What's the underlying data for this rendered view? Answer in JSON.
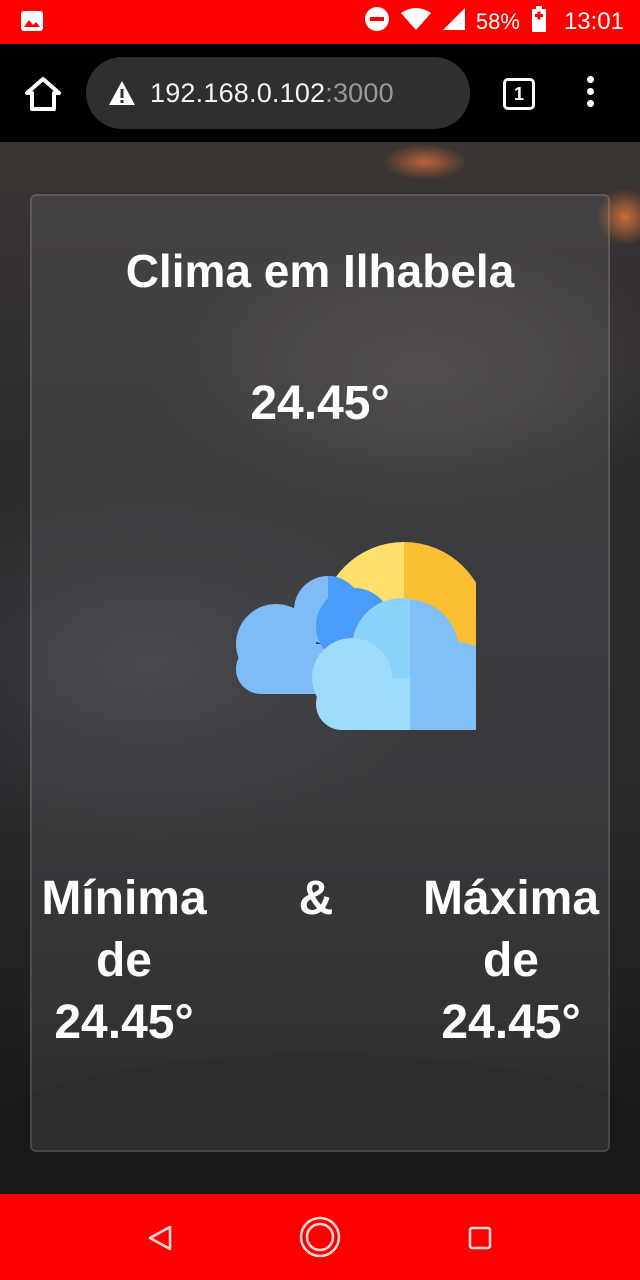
{
  "status_bar": {
    "battery": "58%",
    "time": "13:01",
    "icons": [
      "image-icon",
      "do-not-disturb-icon",
      "wifi-icon",
      "signal-icon",
      "battery-icon"
    ]
  },
  "browser": {
    "url_host": "192.168.0.102",
    "url_port": ":3000",
    "tab_count": "1",
    "icons": [
      "home-icon",
      "warning-icon",
      "tabs-icon",
      "menu-icon"
    ]
  },
  "weather": {
    "title": "Clima em Ilhabela",
    "temperature": "24.45°",
    "icon": "partly-cloudy-icon",
    "min_label_1": "Mínima",
    "min_label_2": "de",
    "min_value": "24.45°",
    "separator": "&",
    "max_label_1": "Máxima",
    "max_label_2": "de",
    "max_value": "24.45°"
  },
  "nav_bar": {
    "icons": [
      "back-icon",
      "home-circle-icon",
      "recent-apps-icon"
    ]
  },
  "colors": {
    "system_bars": "#ff0000",
    "toolbar": "#000000",
    "url_bar": "#2f2f31",
    "sun": "#fbbf24",
    "cloud_light": "#8ad3fa",
    "cloud_dark": "#4a9cf9"
  }
}
